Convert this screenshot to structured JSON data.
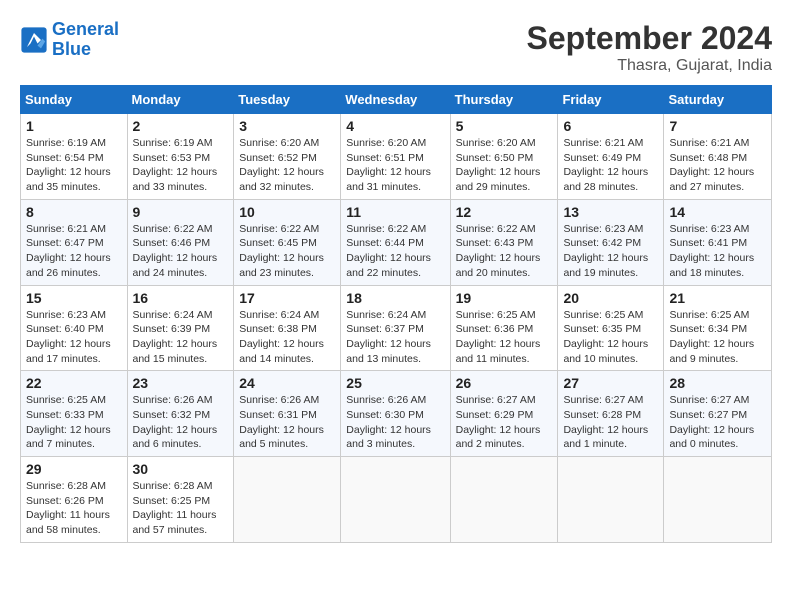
{
  "logo": {
    "line1": "General",
    "line2": "Blue"
  },
  "title": "September 2024",
  "subtitle": "Thasra, Gujarat, India",
  "days_header": [
    "Sunday",
    "Monday",
    "Tuesday",
    "Wednesday",
    "Thursday",
    "Friday",
    "Saturday"
  ],
  "weeks": [
    [
      {
        "day": "1",
        "sunrise": "6:19 AM",
        "sunset": "6:54 PM",
        "daylight": "12 hours and 35 minutes."
      },
      {
        "day": "2",
        "sunrise": "6:19 AM",
        "sunset": "6:53 PM",
        "daylight": "12 hours and 33 minutes."
      },
      {
        "day": "3",
        "sunrise": "6:20 AM",
        "sunset": "6:52 PM",
        "daylight": "12 hours and 32 minutes."
      },
      {
        "day": "4",
        "sunrise": "6:20 AM",
        "sunset": "6:51 PM",
        "daylight": "12 hours and 31 minutes."
      },
      {
        "day": "5",
        "sunrise": "6:20 AM",
        "sunset": "6:50 PM",
        "daylight": "12 hours and 29 minutes."
      },
      {
        "day": "6",
        "sunrise": "6:21 AM",
        "sunset": "6:49 PM",
        "daylight": "12 hours and 28 minutes."
      },
      {
        "day": "7",
        "sunrise": "6:21 AM",
        "sunset": "6:48 PM",
        "daylight": "12 hours and 27 minutes."
      }
    ],
    [
      {
        "day": "8",
        "sunrise": "6:21 AM",
        "sunset": "6:47 PM",
        "daylight": "12 hours and 26 minutes."
      },
      {
        "day": "9",
        "sunrise": "6:22 AM",
        "sunset": "6:46 PM",
        "daylight": "12 hours and 24 minutes."
      },
      {
        "day": "10",
        "sunrise": "6:22 AM",
        "sunset": "6:45 PM",
        "daylight": "12 hours and 23 minutes."
      },
      {
        "day": "11",
        "sunrise": "6:22 AM",
        "sunset": "6:44 PM",
        "daylight": "12 hours and 22 minutes."
      },
      {
        "day": "12",
        "sunrise": "6:22 AM",
        "sunset": "6:43 PM",
        "daylight": "12 hours and 20 minutes."
      },
      {
        "day": "13",
        "sunrise": "6:23 AM",
        "sunset": "6:42 PM",
        "daylight": "12 hours and 19 minutes."
      },
      {
        "day": "14",
        "sunrise": "6:23 AM",
        "sunset": "6:41 PM",
        "daylight": "12 hours and 18 minutes."
      }
    ],
    [
      {
        "day": "15",
        "sunrise": "6:23 AM",
        "sunset": "6:40 PM",
        "daylight": "12 hours and 17 minutes."
      },
      {
        "day": "16",
        "sunrise": "6:24 AM",
        "sunset": "6:39 PM",
        "daylight": "12 hours and 15 minutes."
      },
      {
        "day": "17",
        "sunrise": "6:24 AM",
        "sunset": "6:38 PM",
        "daylight": "12 hours and 14 minutes."
      },
      {
        "day": "18",
        "sunrise": "6:24 AM",
        "sunset": "6:37 PM",
        "daylight": "12 hours and 13 minutes."
      },
      {
        "day": "19",
        "sunrise": "6:25 AM",
        "sunset": "6:36 PM",
        "daylight": "12 hours and 11 minutes."
      },
      {
        "day": "20",
        "sunrise": "6:25 AM",
        "sunset": "6:35 PM",
        "daylight": "12 hours and 10 minutes."
      },
      {
        "day": "21",
        "sunrise": "6:25 AM",
        "sunset": "6:34 PM",
        "daylight": "12 hours and 9 minutes."
      }
    ],
    [
      {
        "day": "22",
        "sunrise": "6:25 AM",
        "sunset": "6:33 PM",
        "daylight": "12 hours and 7 minutes."
      },
      {
        "day": "23",
        "sunrise": "6:26 AM",
        "sunset": "6:32 PM",
        "daylight": "12 hours and 6 minutes."
      },
      {
        "day": "24",
        "sunrise": "6:26 AM",
        "sunset": "6:31 PM",
        "daylight": "12 hours and 5 minutes."
      },
      {
        "day": "25",
        "sunrise": "6:26 AM",
        "sunset": "6:30 PM",
        "daylight": "12 hours and 3 minutes."
      },
      {
        "day": "26",
        "sunrise": "6:27 AM",
        "sunset": "6:29 PM",
        "daylight": "12 hours and 2 minutes."
      },
      {
        "day": "27",
        "sunrise": "6:27 AM",
        "sunset": "6:28 PM",
        "daylight": "12 hours and 1 minute."
      },
      {
        "day": "28",
        "sunrise": "6:27 AM",
        "sunset": "6:27 PM",
        "daylight": "12 hours and 0 minutes."
      }
    ],
    [
      {
        "day": "29",
        "sunrise": "6:28 AM",
        "sunset": "6:26 PM",
        "daylight": "11 hours and 58 minutes."
      },
      {
        "day": "30",
        "sunrise": "6:28 AM",
        "sunset": "6:25 PM",
        "daylight": "11 hours and 57 minutes."
      },
      null,
      null,
      null,
      null,
      null
    ]
  ]
}
